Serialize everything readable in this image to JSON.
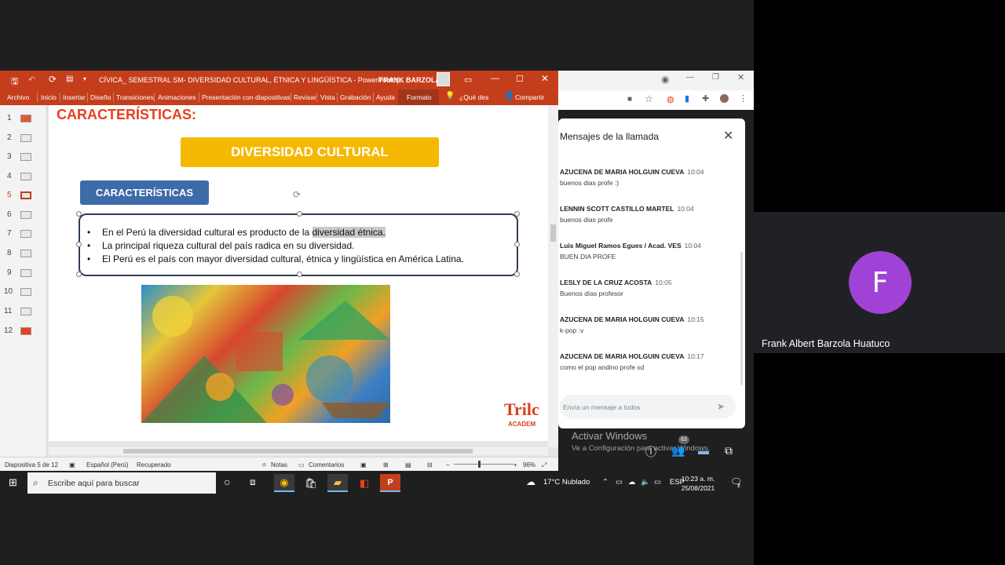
{
  "ppt": {
    "window_title": "CÍVICA_ SEMESTRAL SM- DIVERSIDAD CULTURAL, ÉTNICA Y LINGÜÍSTICA - PowerPoint (...",
    "user_name": "FRANK BARZOLA",
    "ribbon_tabs": [
      "Archivo",
      "Inicio",
      "Insertar",
      "Diseño",
      "Transiciones",
      "Animaciones",
      "Presentación con diapositivas",
      "Revisar",
      "Vista",
      "Grabación",
      "Ayuda",
      "Formato"
    ],
    "tell_me": "¿Qué des",
    "share": "Compartir",
    "slides": [
      "1",
      "2",
      "3",
      "4",
      "5",
      "6",
      "7",
      "8",
      "9",
      "10",
      "11",
      "12"
    ],
    "active_slide": "5",
    "status": {
      "slide_counter": "Diapositiva 5 de 12",
      "language": "Español (Perú)",
      "recovered": "Recuperado",
      "notes": "Notas",
      "comments": "Comentarios",
      "zoom": "96%"
    }
  },
  "slide": {
    "heading": "CARACTERÍSTICAS:",
    "banner": "DIVERSIDAD CULTURAL",
    "subtab": "CARACTERÍSTICAS",
    "bullet1_pre": "En el Perú la diversidad cultural es producto de la ",
    "bullet1_hl": "diversidad étnica.",
    "bullet2": "La principal riqueza cultural del país radica en su diversidad.",
    "bullet3": "El Perú es el país con mayor diversidad cultural, étnica y lingüística en América Latina.",
    "logo": "Trilc",
    "logo_sub": "ACADEM"
  },
  "chat": {
    "title": "Mensajes de la llamada",
    "messages": [
      {
        "sender": "AZUCENA DE MARIA HOLGUIN CUEVA",
        "time": "10:04",
        "text": "buenos dias profe :)"
      },
      {
        "sender": "LENNIN SCOTT CASTILLO MARTEL",
        "time": "10:04",
        "text": "buenos dias profe"
      },
      {
        "sender": "Luis Miguel Ramos Egues / Acad. VES",
        "time": "10:04",
        "text": "BUEN DIA PROFE"
      },
      {
        "sender": "LESLY DE LA CRUZ ACOSTA",
        "time": "10:05",
        "text": "Buenos días profesor"
      },
      {
        "sender": "AZUCENA DE MARIA HOLGUIN CUEVA",
        "time": "10:15",
        "text": "k-pop :v"
      },
      {
        "sender": "AZUCENA DE MARIA HOLGUIN CUEVA",
        "time": "10:17",
        "text": "como el pop andino profe xd"
      }
    ],
    "input_placeholder": "Envía un mensaje a todos"
  },
  "meet": {
    "activate_title": "Activar Windows",
    "activate_sub": "Ve a Configuración para activar Windows.",
    "participants_count": "63",
    "participant_initial": "F",
    "participant_name": "Frank Albert Barzola Huatuco"
  },
  "taskbar": {
    "search_placeholder": "Escribe aquí para buscar",
    "weather": "17°C  Nublado",
    "lang": "ESP",
    "time": "10:23 a. m.",
    "date": "25/08/2021",
    "notifications": "2"
  },
  "colors": {
    "ppt_accent": "#c43e1c",
    "banner": "#f5b800",
    "subtab": "#3e6aa8",
    "avatar": "#a142d6"
  }
}
